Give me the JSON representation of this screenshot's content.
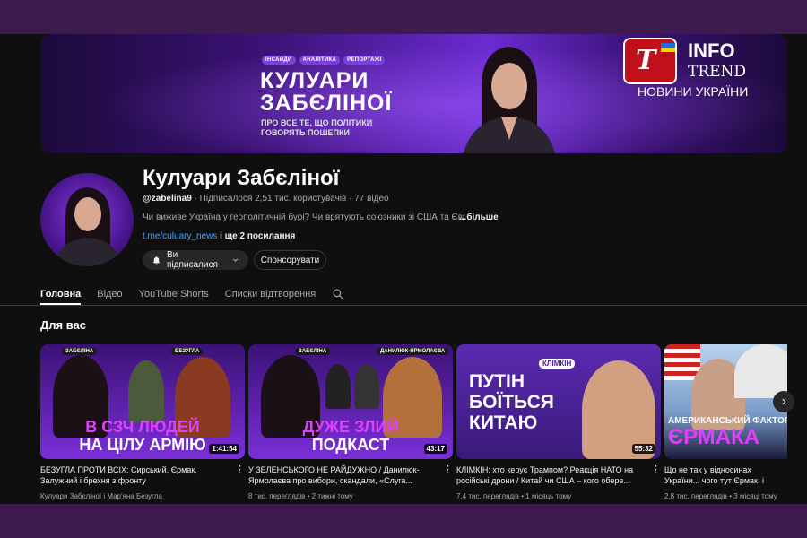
{
  "banner": {
    "tags": [
      "ІНСАЙДИ",
      "АНАЛІТИКА",
      "РЕПОРТАЖІ"
    ],
    "title_line1": "КУЛУАРИ",
    "title_line2": "ЗАБЄЛІНОЇ",
    "subtitle": "ПРО ВСЕ ТЕ, ЩО ПОЛІТИКИ ГОВОРЯТЬ ПОШЕПКИ"
  },
  "watermark": {
    "info": "INFO",
    "trend": "TREND",
    "news": "НОВИНИ УКРАЇНИ",
    "mark": "T"
  },
  "channel": {
    "name": "Кулуари Забєліної",
    "handle": "@zabelina9",
    "subscribers": "Підписалося 2,51 тис. користувачів",
    "videos": "77 відео",
    "description": "Чи виживе Україна у геополітичній бурі? Чи врятують союзники зі США та Європ",
    "more_label": "...більше",
    "link": "t.me/culuary_news",
    "more_links": "і ще 2 посилання",
    "subscribed_label": "Ви підписалися",
    "sponsor_label": "Спонсорувати"
  },
  "tabs": [
    "Головна",
    "Відео",
    "YouTube Shorts",
    "Списки відтворення"
  ],
  "section_title": "Для вас",
  "videos": [
    {
      "labels": [
        "ЗАБЄЛІНА",
        "БЕЗУГЛА"
      ],
      "text_line1": "В СЗЧ ЛЮДЕЙ",
      "text_line2": "НА ЦІЛУ АРМІЮ",
      "duration": "1:41:54",
      "title": "БЕЗУГЛА ПРОТИ ВСІХ: Сирський, Єрмак, Залужний і брехня з фронту",
      "meta": "Кулуари Забєліної і Мар'яна Безугла"
    },
    {
      "labels": [
        "ЗАБЄЛІНА",
        "ДАНИЛЮК-ЯРМОЛАЄВА"
      ],
      "text_line1": "ДУЖЕ ЗЛИЙ",
      "text_line2": "ПОДКАСТ",
      "duration": "43:17",
      "title": "У ЗЕЛЕНСЬКОГО НЕ РАЙДУЖНО / Данилюк-Ярмолаєва про вибори, скандали, «Слуга...",
      "meta": "8 тис. переглядів • 2 тижні тому"
    },
    {
      "labels": [
        "КЛІМКІН"
      ],
      "text_line1": "ПУТІН",
      "text_line2": "БОЇТЬСЯ",
      "text_line3": "КИТАЮ",
      "duration": "55:32",
      "title": "КЛІМКІН: хто керує Трампом? Реакція НАТО на російські дрони / Китай чи США – кого обере...",
      "meta": "7,4 тис. переглядів • 1 місяць тому"
    },
    {
      "labels": [],
      "text_line1": "АМЕРИКАНСЬКИЙ ФАКТОР",
      "text_line2": "ЄРМАКА",
      "duration": "",
      "title": "Що не так у відносинах України... чого тут Єрмак, і стаття у Politic...",
      "meta": "2,8 тис. переглядів • 3 місяці тому"
    }
  ],
  "colors": {
    "accent": "#7b3fe0",
    "link": "#3ea6ff",
    "background": "#0f0f0f",
    "frame": "#3d1b4d",
    "highlight_pink": "#e040fb"
  }
}
